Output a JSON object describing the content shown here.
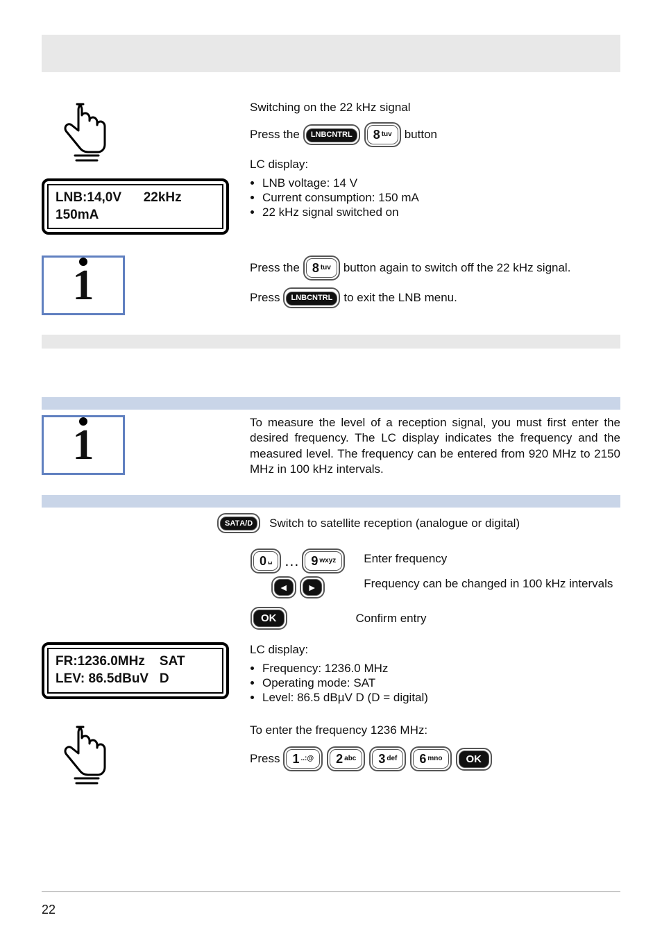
{
  "keys": {
    "lnb_top": "LNB",
    "lnb_bottom": "CNTRL",
    "sat_top": "SAT",
    "sat_bottom": "A/D",
    "ok": "OK",
    "left": "◄",
    "right": "►",
    "d0_big": "0",
    "d0_sub": "␣",
    "d1_big": "1",
    "d1_sub": "..:@",
    "d2_big": "2",
    "d2_sub": "abc",
    "d3_big": "3",
    "d3_sub": "def",
    "d6_big": "6",
    "d6_sub": "mno",
    "d8_big": "8",
    "d8_sub": "tuv",
    "d9_big": "9",
    "d9_sub": "wxyz"
  },
  "sec1": {
    "title": "Switching on the 22 kHz signal",
    "press_the": "Press the",
    "button_word": "button",
    "lc_display_label": "LC display:",
    "b1": "LNB voltage: 14 V",
    "b2": "Current consumption: 150 mA",
    "b3": "22 kHz signal switched on",
    "lcd_line1": "LNB:14,0V      22kHz",
    "lcd_line2": "150mA",
    "info_line1_a": "Press the",
    "info_line1_b": "button again to switch off the 22 kHz signal.",
    "info_line2_a": "Press",
    "info_line2_b": "to exit the LNB menu."
  },
  "sec2": {
    "info_para": "To measure the level of a reception signal, you must first enter the desired frequency. The LC display indicates the frequency and the measured level. The frequency can be entered from 920 MHz to 2150 MHz in 100 kHz intervals.",
    "switch_line": "Switch to satellite reception (analogue or digital)",
    "enter_freq": "Enter frequency",
    "freq_change": "Frequency can be changed in 100 kHz intervals",
    "confirm": "Confirm entry",
    "lc_display_label": "LC display:",
    "b1": "Frequency: 1236.0 MHz",
    "b2": "Operating mode: SAT",
    "b3": "Level: 86.5 dBµV D (D = digital)",
    "lcd_line1": "FR:1236.0MHz    SAT",
    "lcd_line2": "LEV: 86.5dBuV   D",
    "enter_example": "To enter the frequency 1236 MHz:",
    "press_word": "Press"
  },
  "page_number": "22"
}
